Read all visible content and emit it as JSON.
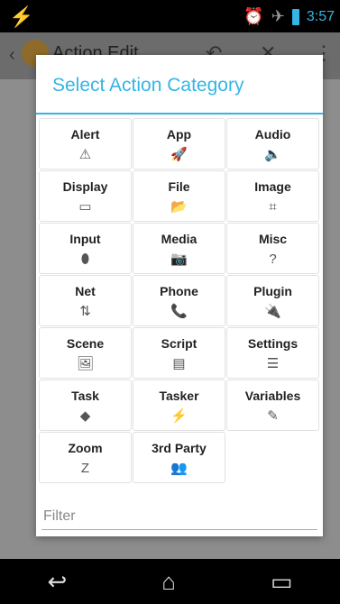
{
  "statusbar": {
    "time": "3:57"
  },
  "actionbar": {
    "title": "Action Edit"
  },
  "dialog": {
    "title": "Select Action Category",
    "categories": [
      {
        "label": "Alert",
        "icon": "⚠"
      },
      {
        "label": "App",
        "icon": "🚀"
      },
      {
        "label": "Audio",
        "icon": "🔈"
      },
      {
        "label": "Display",
        "icon": "▭"
      },
      {
        "label": "File",
        "icon": "📂"
      },
      {
        "label": "Image",
        "icon": "⌗"
      },
      {
        "label": "Input",
        "icon": "⬮"
      },
      {
        "label": "Media",
        "icon": "📷"
      },
      {
        "label": "Misc",
        "icon": "?"
      },
      {
        "label": "Net",
        "icon": "⇅"
      },
      {
        "label": "Phone",
        "icon": "📞"
      },
      {
        "label": "Plugin",
        "icon": "🔌"
      },
      {
        "label": "Scene",
        "icon": "🖼"
      },
      {
        "label": "Script",
        "icon": "▤"
      },
      {
        "label": "Settings",
        "icon": "☰"
      },
      {
        "label": "Task",
        "icon": "◆"
      },
      {
        "label": "Tasker",
        "icon": "⚡"
      },
      {
        "label": "Variables",
        "icon": "✎"
      },
      {
        "label": "Zoom",
        "icon": "Z"
      },
      {
        "label": "3rd Party",
        "icon": "👥"
      }
    ],
    "filter": {
      "placeholder": "Filter"
    }
  }
}
